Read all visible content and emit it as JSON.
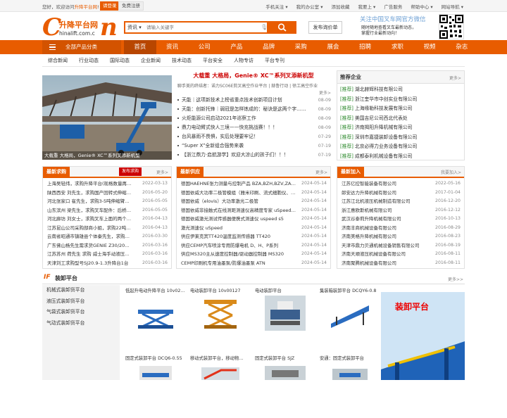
{
  "topbar": {
    "welcome_prefix": "您好，欢迎访问",
    "site_name": "升降平台网",
    "welcome_suffix": "!",
    "login": "请登录",
    "register": "免费注册",
    "links": [
      "手机关注 ▾",
      "我的办公室 ▾",
      "添加收藏",
      "我要上 ▾",
      "广告服务",
      "帮助中心 ▾",
      "网站导航 ▾"
    ]
  },
  "logo": {
    "letter_left": "C",
    "letter_right": "n",
    "title": "升降平台网",
    "domain": "hinalift.com.c"
  },
  "search": {
    "category": "资讯 ▾",
    "placeholder": "请输入关键字",
    "publish": "发布询价单"
  },
  "wechat": {
    "title": "关注中国叉车网官方微信",
    "line1": "随时随地查看叉车最新动态，",
    "line2": "掌握行业最新动向！"
  },
  "nav": {
    "all_categories": "全部产品分类",
    "items": [
      "首页",
      "资讯",
      "公司",
      "产品",
      "品牌",
      "采购",
      "展会",
      "招聘",
      "求职",
      "视频",
      "杂志"
    ]
  },
  "subnav": [
    "综合新闻",
    "行业动态",
    "国际动态",
    "企业新闻",
    "技术动态",
    "平台安全",
    "人物专访",
    "平台专刊"
  ],
  "feature": {
    "caption": "大载重 大格局，Genie® XC™系列叉添新机型"
  },
  "headline": {
    "title": "大载重 大格局，Genie® XC™系列叉添新机型",
    "summary": "聊手美的终结者：诺力SC06E剪叉高空作业平台 | 赫鲁行动 | 徐工高空作业",
    "more": "更多>",
    "items": [
      {
        "text": "天能｜这项新技术上榜省重点技术创新项目计划",
        "date": "08-09"
      },
      {
        "text": "天能：创新托锋｜弱冠是怎样炼成的：秘诀是这两个字……",
        "date": "08-09"
      },
      {
        "text": "火炬能源公司启动2021年巡察工作",
        "date": "08-09"
      },
      {
        "text": "鼎力电动臂式快人三境——快充挑战赛！！！",
        "date": "08-09"
      },
      {
        "text": "台风暴雨不畏惧，实后处理要牢记！",
        "date": "07-29"
      },
      {
        "text": "“Super X”全新组合强势来袭",
        "date": "07-19"
      },
      {
        "text": "【浙江鼎力·启航游学】欢迎大凉山的孩子们！！！",
        "date": "07-19"
      }
    ]
  },
  "recommend": {
    "title": "推荐企业",
    "more": "更多>",
    "tag": "[推荐]",
    "items": [
      "湖北赫辉科技有限公司",
      "浙江奎华市中创实业有限公司",
      "上海缘勒科技发展有限公司",
      "美国吉尼公司西北代表处",
      "济南揭阳升降机械有限公司",
      "深圳市嘉捷装卸设备有限公司",
      "北京必得力业务设备有限公司",
      "成都泰利机械设备有限公司"
    ]
  },
  "buy": {
    "title": "最新求购",
    "publish": "发布求购",
    "more": "更多>",
    "items": [
      {
        "text": "上海吴轻纬，求购升降平台(现格数量再…",
        "date": "2022-03-13"
      },
      {
        "text": "陕西西安 刘先生，求购国产回转式伸缩…",
        "date": "2016-05-20"
      },
      {
        "text": "河北张家口 崔先生，求购3-5吨伸缩臂…",
        "date": "2016-05-05"
      },
      {
        "text": "山东滨州 梁先生，求购叉车配件：后桥…",
        "date": "2016-05-05"
      },
      {
        "text": "河北廊坊 刘女士，求购叉车上面的两个…",
        "date": "2016-04-13"
      },
      {
        "text": "江苏昆山公司采购部商小姐，求购22吨…",
        "date": "2016-04-13"
      },
      {
        "text": "云南省昭通市镇雄县个体秦先生，求购…",
        "date": "2016-03-30"
      },
      {
        "text": "广东佛山杨先生需求货GENIE Z30/20…",
        "date": "2016-03-16"
      },
      {
        "text": "江苏苏州 荷先生 求购 威士海手动液压…",
        "date": "2016-03-16"
      },
      {
        "text": "天津刘工求购型号SJ20.9-1.3升降台1台",
        "date": "2016-03-16"
      }
    ]
  },
  "supply": {
    "title": "最新供应",
    "more": "更多>",
    "items": [
      {
        "text": "德国HAEHNE张力测量与控制产品 BZA,BZH,BZV,ZA…",
        "date": "2024-05-14"
      },
      {
        "text": "德国依威大功率二极管模组（雅米印刷、流式细胞仪、…",
        "date": "2024-05-14"
      },
      {
        "text": "德国依威（elovis）大功率激光二极管",
        "date": "2024-05-14"
      },
      {
        "text": "德国依威非接触式在线测距测速仪高精度专家 uSpeed…",
        "date": "2024-05-14"
      },
      {
        "text": "德国依威激光测试传感器便携式测速仪 uspeed s5",
        "date": "2024-05-14"
      },
      {
        "text": "激光测速仪 uSpeed",
        "date": "2024-05-14"
      },
      {
        "text": "供应伊莱克宾TT420温度监测传感器 TT420",
        "date": "2024-05-14"
      },
      {
        "text": "供应CEMP汽车喷涂专用防爆电机 D、H、P系列",
        "date": "2024-05-14"
      },
      {
        "text": "供应MS320主从速度控制器/驱动器控制器 MS320",
        "date": "2024-05-14"
      },
      {
        "text": "CEMP印刷机专用油墨泵/防爆油墨泵 ATN",
        "date": "2024-05-14"
      }
    ]
  },
  "newjoin": {
    "title": "最新加入",
    "more": "我要加入>",
    "items": [
      {
        "text": "江苏亿控智能装备有限公司",
        "date": "2022-05-16"
      },
      {
        "text": "郎安达力升降机械有限公司",
        "date": "2017-01-04"
      },
      {
        "text": "江苏江北机液压机械制造有限公司",
        "date": "2016-12-20"
      },
      {
        "text": "浙江惠欧斯机械有限公司",
        "date": "2016-12-12"
      },
      {
        "text": "武汉谷泰莉升降机械有限公司",
        "date": "2016-10-13"
      },
      {
        "text": "济南丰商机械设备有限公司",
        "date": "2016-08-29"
      },
      {
        "text": "济南美格升降机械有限公司",
        "date": "2016-08-23"
      },
      {
        "text": "天津市鼎力贝通机械设备销售有限公司",
        "date": "2016-08-19"
      },
      {
        "text": "济南天顺液压机械设备有限公司",
        "date": "2016-08-11"
      },
      {
        "text": "济南聚腾机械设备有限公司",
        "date": "2016-08-11"
      }
    ]
  },
  "ifsection": {
    "badge": "IF",
    "title": "装卸平台",
    "more": "更多>>",
    "side": [
      "机械式装卸货平台",
      "液压式装卸货平台",
      "气袋式装卸货平台",
      "气动式装卸货平台"
    ],
    "products": [
      "低起升电动升降平台 10v02…",
      "电动装卸平台 10v00127",
      "电动装卸平台",
      "集装箱装卸平台 DCQY6-0.8",
      "固定式装卸平台 DCQ6-0.55",
      "移动式装卸平台，移动物…",
      "固定式装卸平台 SJZ",
      "安通：固定式装卸平台"
    ],
    "banner": "装卸平台"
  },
  "colors": {
    "brand": "#e85c00",
    "brand_dark": "#d35300",
    "nav_active": "#b84600",
    "tag_green": "#2f8b2f",
    "headline_red": "#cc0000"
  }
}
